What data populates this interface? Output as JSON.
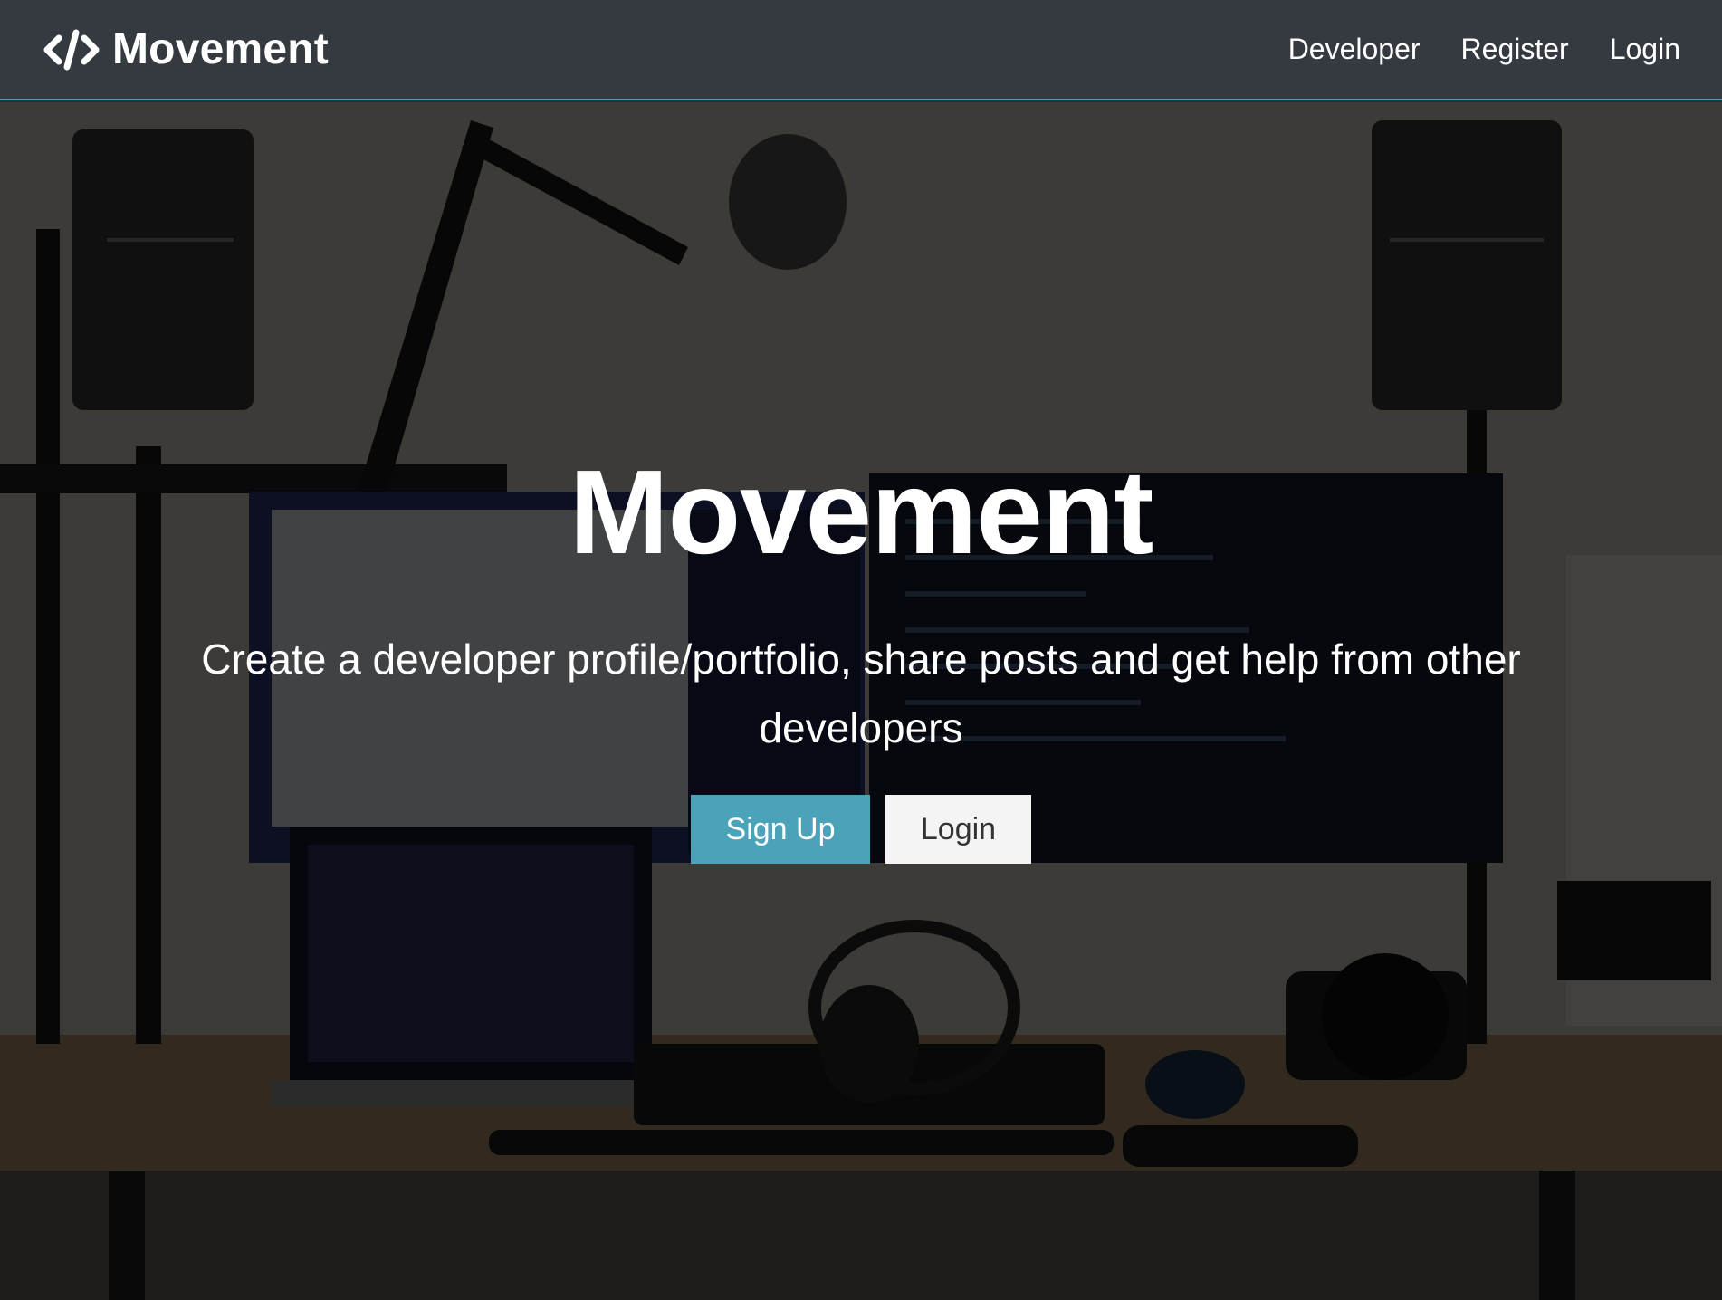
{
  "navbar": {
    "brand_label": "Movement",
    "brand_icon": "code-icon",
    "links": [
      {
        "label": "Developer"
      },
      {
        "label": "Register"
      },
      {
        "label": "Login"
      }
    ],
    "accent_color": "#3aa3b6"
  },
  "landing": {
    "title": "Movement",
    "lead": "Create a developer profile/portfolio, share posts and get help from other developers",
    "buttons": {
      "signup_label": "Sign Up",
      "login_label": "Login"
    },
    "colors": {
      "primary": "#4aa3b8",
      "light": "#f4f4f4"
    }
  }
}
